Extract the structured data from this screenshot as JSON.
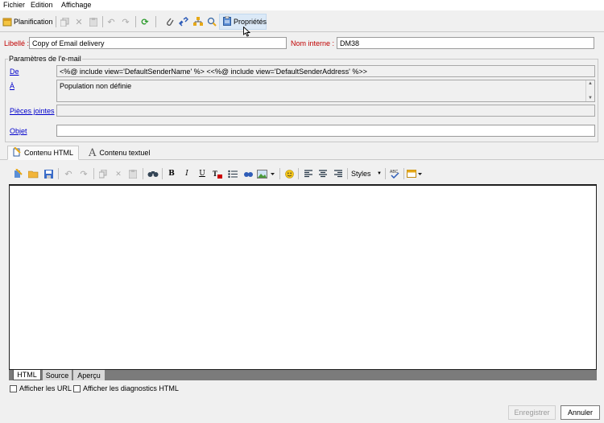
{
  "menu": {
    "items": [
      "Fichier",
      "Edition",
      "Affichage"
    ]
  },
  "toolbar": {
    "planification_label": "Planification",
    "properties_label": "Propriétés"
  },
  "form": {
    "libelle_label": "Libellé :",
    "libelle_value": "Copy of Email delivery",
    "nom_interne_label": "Nom interne :",
    "nom_interne_value": "DM38"
  },
  "email_params": {
    "group_title": "Paramètres de l'e-mail",
    "de_label": "De",
    "de_value": "<%@ include view='DefaultSenderName' %> <<%@ include view='DefaultSenderAddress' %>>",
    "a_label": "À",
    "a_value": "Population non définie",
    "pieces_jointes_label": "Pièces jointes",
    "objet_label": "Objet",
    "objet_value": ""
  },
  "tabs": {
    "html_label": "Contenu HTML",
    "text_label": "Contenu textuel"
  },
  "editor_toolbar": {
    "styles_label": "Styles"
  },
  "view_tabs": {
    "html": "HTML",
    "source": "Source",
    "apercu": "Aperçu"
  },
  "options": {
    "show_urls": "Afficher les URL",
    "show_diag": "Afficher les diagnostics HTML"
  },
  "buttons": {
    "save": "Enregistrer",
    "cancel": "Annuler"
  }
}
